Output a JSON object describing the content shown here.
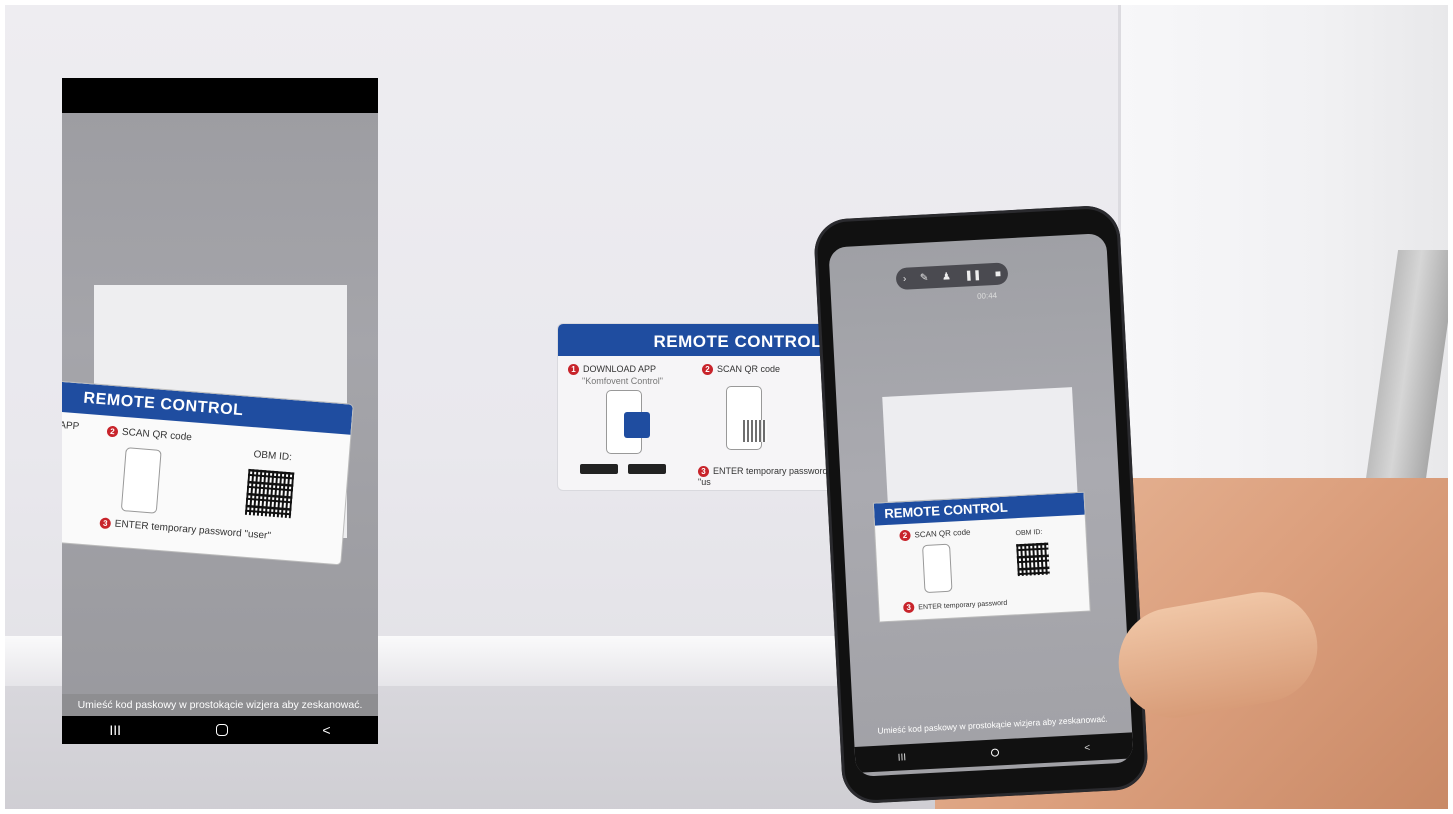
{
  "wall_label": {
    "title": "REMOTE CONTROL",
    "step1": "DOWNLOAD APP",
    "step1_sub": "\"Komfovent Control\"",
    "step2": "SCAN QR code",
    "step3": "ENTER temporary password \"us",
    "step1_num": "1",
    "step2_num": "2",
    "step3_num": "3"
  },
  "left_screen": {
    "card_title": "REMOTE CONTROL",
    "card_step_app": "APP",
    "card_step2": "SCAN QR code",
    "card_qr_label": "OBM ID:",
    "card_step3": "ENTER temporary password \"user\"",
    "hint_text": "Umieść kod paskowy w prostokącie wizjera aby zeskanować.",
    "nav": {
      "recents": "III",
      "back": "<"
    }
  },
  "right_device": {
    "card_title": "REMOTE CONTROL",
    "card_step2": "SCAN QR code",
    "card_qr_label": "OBM ID:",
    "card_step3": "ENTER temporary password",
    "hint_text": "Umieść kod paskowy w prostokącie wizjera aby zeskanować.",
    "rec_time": "00:44",
    "nav": {
      "recents": "III",
      "back": "<"
    }
  },
  "colors": {
    "brand_blue": "#1f4da0",
    "step_red": "#c8242b"
  }
}
